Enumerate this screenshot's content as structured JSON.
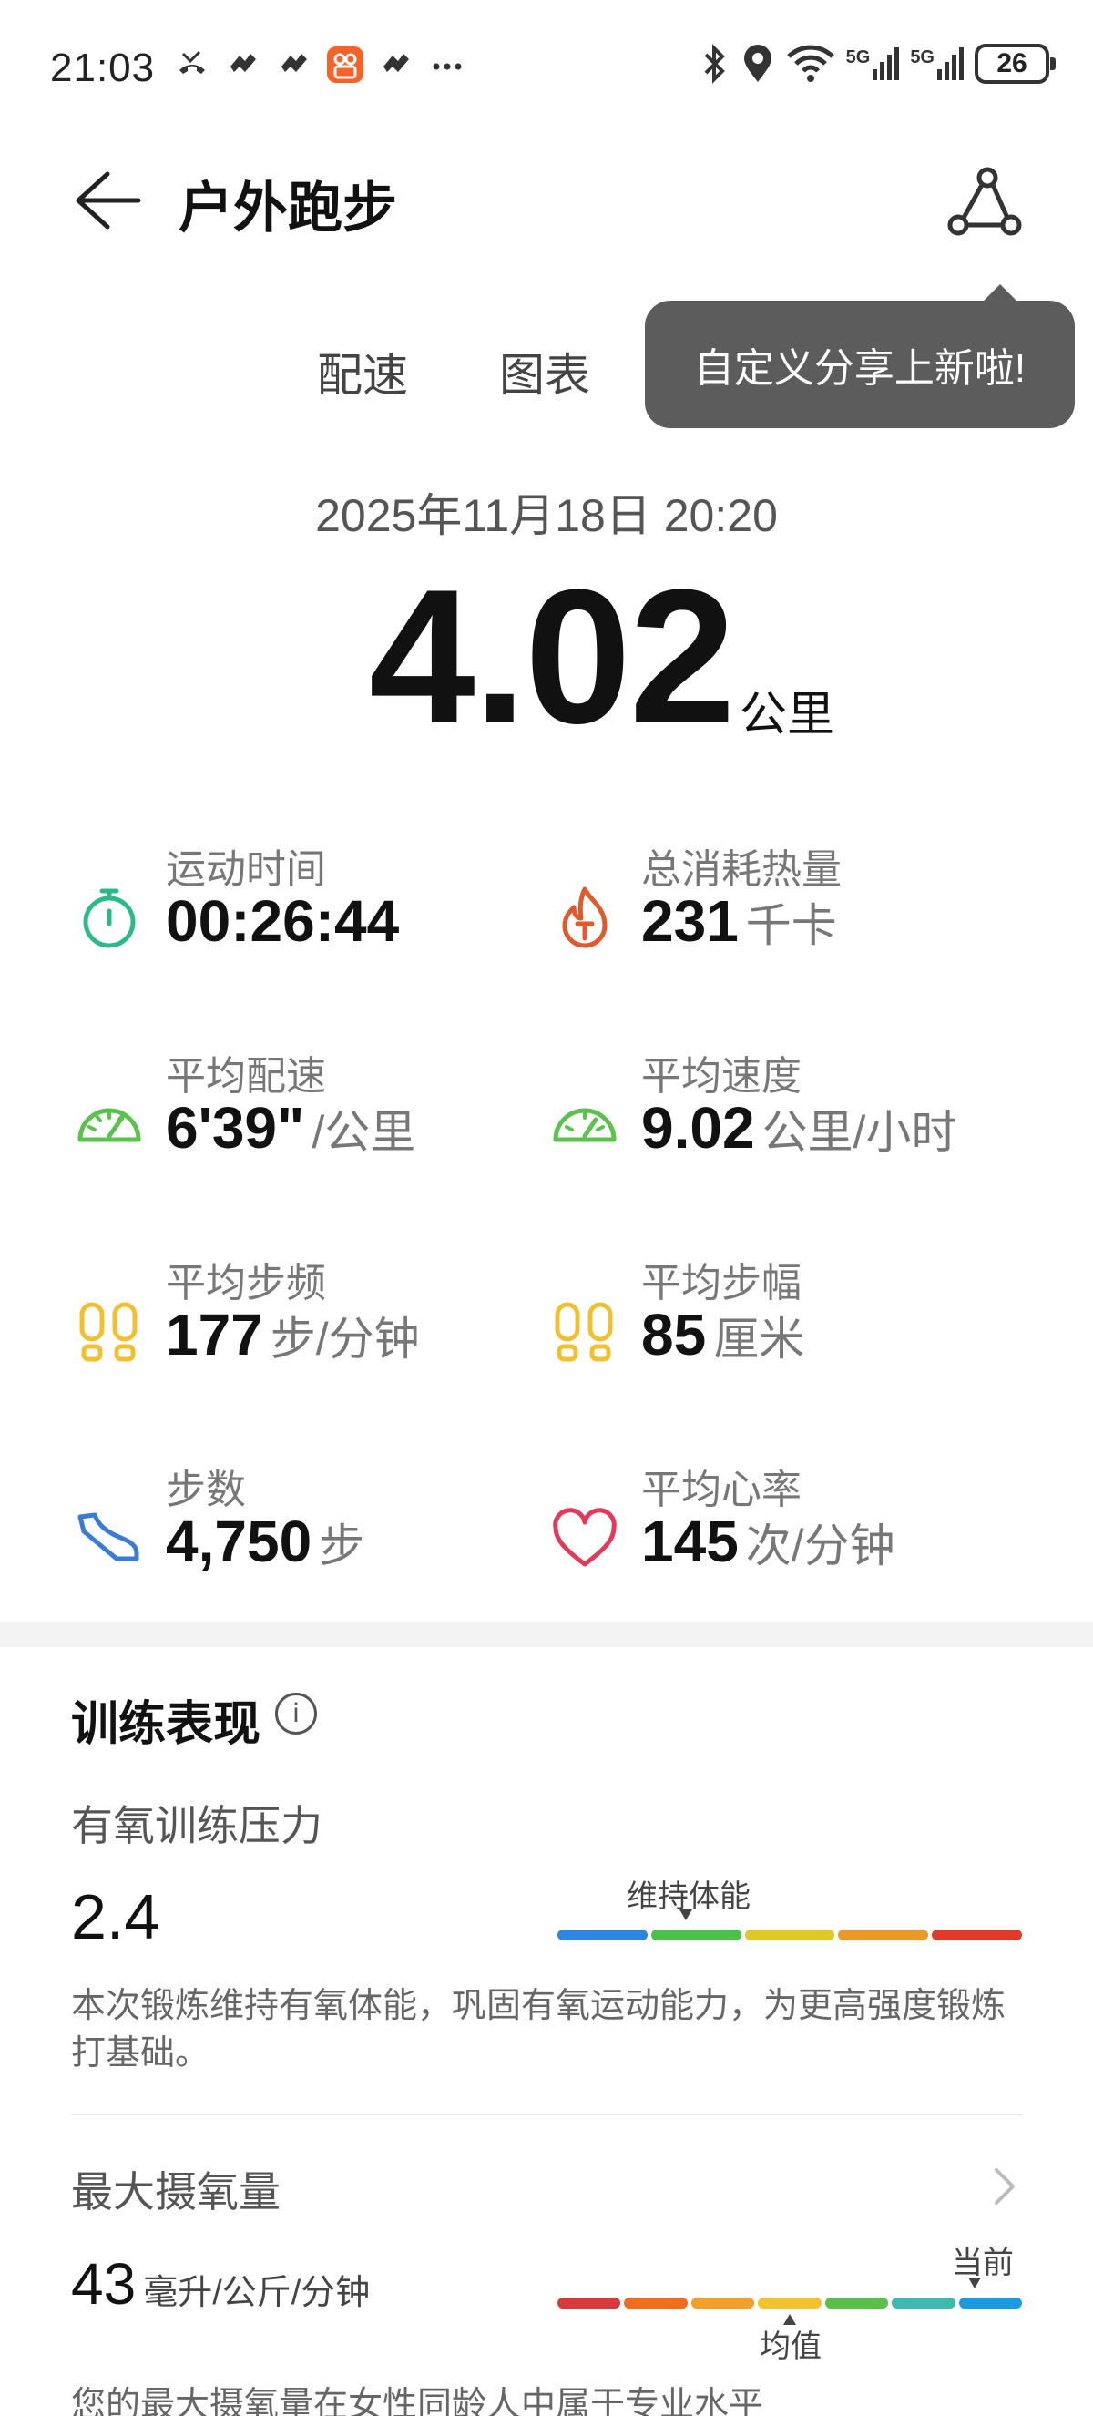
{
  "status_bar": {
    "time": "21:03",
    "network": "5G",
    "network2": "5G",
    "battery": "26"
  },
  "header": {
    "title": "户外跑步"
  },
  "tabs": [
    {
      "label": "配速"
    },
    {
      "label": "图表"
    }
  ],
  "tooltip": {
    "text": "自定义分享上新啦!"
  },
  "summary": {
    "datetime": "2025年11月18日 20:20",
    "distance": "4.02",
    "distance_unit": "公里"
  },
  "metrics": [
    {
      "label": "运动时间",
      "value": "00:26:44",
      "unit": "",
      "icon": "stopwatch-icon",
      "color": "#2bb98b"
    },
    {
      "label": "总消耗热量",
      "value": "231",
      "unit": "千卡",
      "icon": "flame-icon",
      "color": "#e05a2b"
    },
    {
      "label": "平均配速",
      "value": "6'39\"",
      "unit": "/公里",
      "icon": "gauge-icon",
      "color": "#5cc24e"
    },
    {
      "label": "平均速度",
      "value": "9.02",
      "unit": "公里/小时",
      "icon": "speedometer-icon",
      "color": "#5cc24e"
    },
    {
      "label": "平均步频",
      "value": "177",
      "unit": "步/分钟",
      "icon": "footprints-icon",
      "color": "#f0c030"
    },
    {
      "label": "平均步幅",
      "value": "85",
      "unit": "厘米",
      "icon": "footprints-icon",
      "color": "#f0c030"
    },
    {
      "label": "步数",
      "value": "4,750",
      "unit": "步",
      "icon": "shoe-icon",
      "color": "#3a7bd5"
    },
    {
      "label": "平均心率",
      "value": "145",
      "unit": "次/分钟",
      "icon": "heart-icon",
      "color": "#e23a5a"
    }
  ],
  "training": {
    "title": "训练表现",
    "load_title": "有氧训练压力",
    "load_value": "2.4",
    "load_tag": "维持体能",
    "load_colors": [
      "#2e86de",
      "#4cc14a",
      "#dfc924",
      "#eb9a2a",
      "#e03a2a"
    ],
    "description": "本次锻炼维持有氧体能，巩固有氧运动能力，为更高强度锻炼打基础。"
  },
  "vo2max": {
    "title": "最大摄氧量",
    "value": "43",
    "unit": "毫升/公斤/分钟",
    "current_label": "当前",
    "average_label": "均值",
    "colors": [
      "#d63a3a",
      "#ef6d1c",
      "#f2a02a",
      "#f2c230",
      "#5cbf4a",
      "#3fb8b0",
      "#1a9be0"
    ],
    "note": "您的最大摄氧量在女性同龄人中属于专业水平"
  }
}
